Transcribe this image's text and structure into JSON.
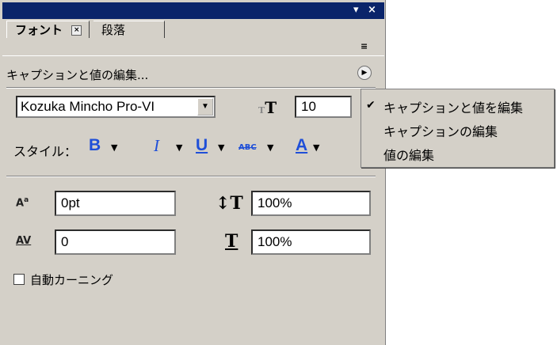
{
  "window": {
    "title": "",
    "minimize_glyph": "▾",
    "close_glyph": "×"
  },
  "tabs": [
    {
      "label": "フォント",
      "close_glyph": "×",
      "active": true
    },
    {
      "label": "段落",
      "active": false
    }
  ],
  "panel_menu_icon": "≡",
  "caption": {
    "label": "キャプションと値の編集...",
    "button_glyph": "▶"
  },
  "font": {
    "family": "Kozuka Mincho Pro-VI",
    "size": "10",
    "dropdown_glyph": "▼",
    "size_icon_glyph": "T"
  },
  "style": {
    "label": "スタイル：",
    "bold_glyph": "B",
    "italic_glyph": "I",
    "underline_glyph": "U",
    "strike_glyph": "ABC",
    "color_glyph": "A",
    "caret": "▼",
    "accent_color": "#1f4fd8"
  },
  "metrics": {
    "baseline_shift": "0pt",
    "vertical_scale": "100%",
    "tracking": "0",
    "horizontal_scale": "100%"
  },
  "auto_kerning": {
    "label": "自動カーニング",
    "checked": false
  },
  "popup_menu": {
    "items": [
      {
        "label": "キャプションと値を編集",
        "checked": true
      },
      {
        "label": "キャプションの編集",
        "checked": false
      },
      {
        "label": "値の編集",
        "checked": false
      }
    ],
    "check_glyph": "✔"
  }
}
